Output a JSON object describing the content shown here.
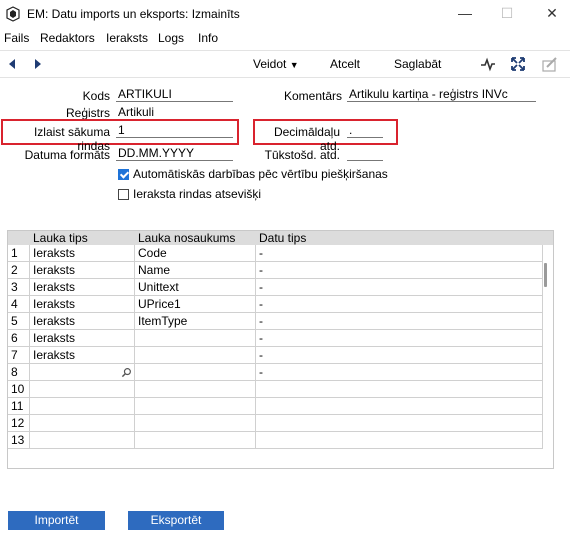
{
  "window": {
    "title": "EM: Datu imports un eksports: Izmainīts",
    "minimize": "—",
    "maximize": "☐",
    "close": "✕"
  },
  "menu": [
    "Fails",
    "Redaktors",
    "Ieraksts",
    "Logs",
    "Info"
  ],
  "toolbar": {
    "create_label": "Veidot",
    "cancel_label": "Atcelt",
    "save_label": "Saglabāt"
  },
  "form": {
    "kods_label": "Kods",
    "kods_value": "ARTIKULI",
    "registrs_label": "Reģistrs",
    "registrs_value": "Artikuli",
    "start_row_label": "Izlaist sākuma rindas",
    "start_row_value": "1",
    "date_format_label": "Datuma formāts",
    "date_format_value": "DD.MM.YYYY",
    "comment_label": "Komentārs",
    "comment_value": "Artikulu kartiņa - reģistrs INVc",
    "decimal_label": "Decimāldaļu atd.",
    "decimal_value": ".",
    "thousands_label": "Tūkstošd. atd.",
    "thousands_value": "",
    "auto_actions_label": "Automātiskās darbības pēc vērtību piešķiršanas",
    "auto_actions_checked": true,
    "separate_rows_label": "Ieraksta rindas atsevišķi",
    "separate_rows_checked": false
  },
  "grid": {
    "columns": [
      "Lauka tips",
      "Lauka nosaukums",
      "Datu tips"
    ],
    "rows": [
      {
        "n": "1",
        "type": "Ieraksts",
        "name": "Code",
        "dtype": "-"
      },
      {
        "n": "2",
        "type": "Ieraksts",
        "name": "Name",
        "dtype": "-"
      },
      {
        "n": "3",
        "type": "Ieraksts",
        "name": "Unittext",
        "dtype": "-"
      },
      {
        "n": "4",
        "type": "Ieraksts",
        "name": "UPrice1",
        "dtype": "-"
      },
      {
        "n": "5",
        "type": "Ieraksts",
        "name": "ItemType",
        "dtype": "-"
      },
      {
        "n": "6",
        "type": "Ieraksts",
        "name": "",
        "dtype": "-"
      },
      {
        "n": "7",
        "type": "Ieraksts",
        "name": "",
        "dtype": "-"
      },
      {
        "n": "8",
        "type": "",
        "name": "",
        "dtype": "-"
      },
      {
        "n": "10",
        "type": "",
        "name": "",
        "dtype": ""
      },
      {
        "n": "11",
        "type": "",
        "name": "",
        "dtype": ""
      },
      {
        "n": "12",
        "type": "",
        "name": "",
        "dtype": ""
      },
      {
        "n": "13",
        "type": "",
        "name": "",
        "dtype": ""
      }
    ]
  },
  "buttons": {
    "import_label": "Importēt",
    "export_label": "Eksportēt"
  }
}
